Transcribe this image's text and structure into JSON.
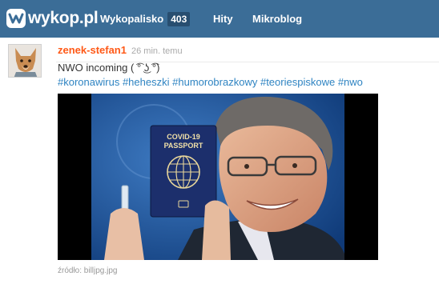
{
  "nav": {
    "logo_text": "wykop.pl",
    "wykopalisko_label": "Wykopalisko",
    "wykopalisko_count": "403",
    "hity_label": "Hity",
    "mikroblog_label": "Mikroblog"
  },
  "entry": {
    "author": "zenek-stefan1",
    "time": "26 min. temu",
    "text": "NWO incoming ( ͡° ͜ʖ ͡°)",
    "tags": [
      "#koronawirus",
      "#heheszki",
      "#humorobrazkowy",
      "#teoriespiskowe",
      "#nwo"
    ],
    "source_label": "źródło:",
    "source_file": "billjpg.jpg",
    "passport_line1": "COVID-19",
    "passport_line2": "PASSPORT"
  },
  "colors": {
    "topbar": "#3b6d97",
    "author": "#ff5917",
    "tag": "#2f84c2",
    "badge": "#284e70"
  },
  "icons": {
    "logo": "wykop-logo-icon",
    "avatar": "dog-avatar",
    "globe": "globe-icon"
  }
}
